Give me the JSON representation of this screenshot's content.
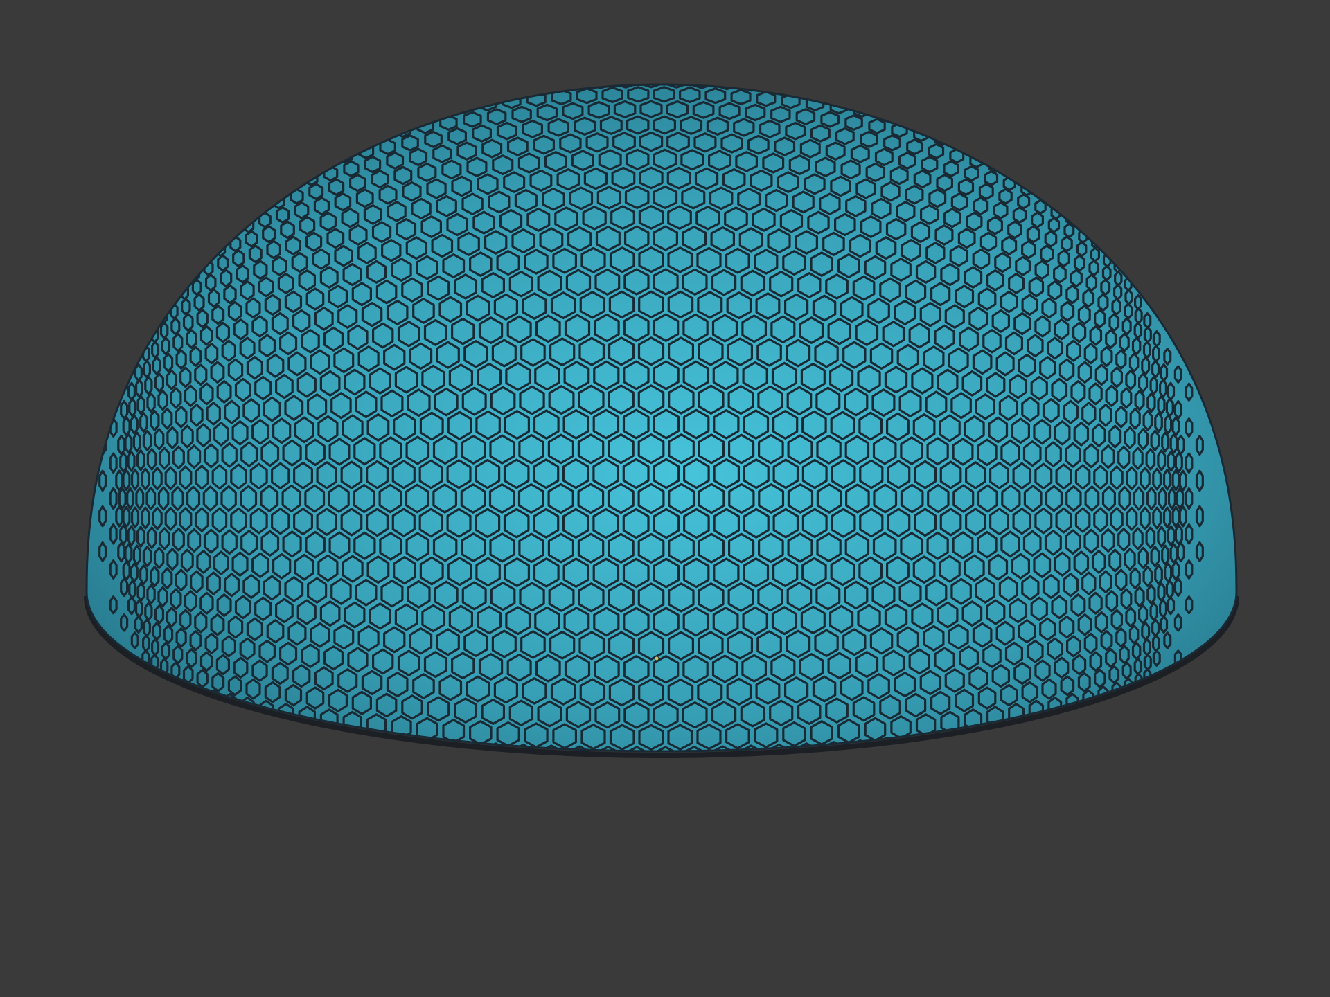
{
  "viewport": {
    "background_color": "#3a3a3a",
    "render_mode": "shaded-with-wireframe-edges"
  },
  "model": {
    "shape": "hemisphere",
    "surface_pattern": "hexagonal-tiling",
    "surface_color_light": "#46c3da",
    "surface_color_mid": "#379fb5",
    "surface_color_dark": "#1f6577",
    "edge_color": "#1a2a35",
    "pivot_marker_color": "#c8c070"
  }
}
